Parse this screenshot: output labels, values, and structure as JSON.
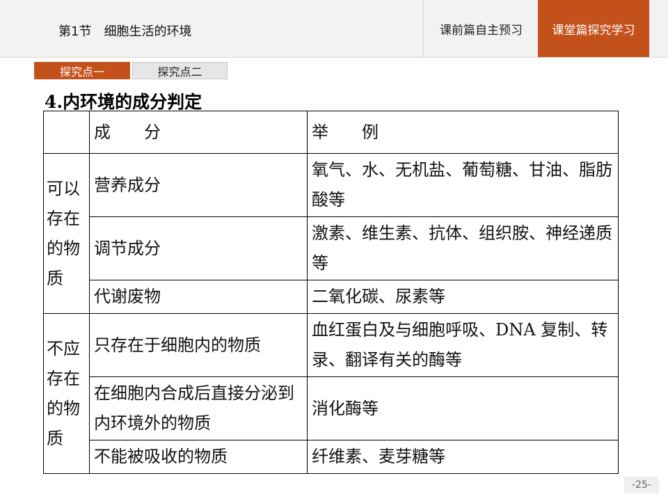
{
  "header": {
    "section_label": "第1节　细胞生活的环境",
    "nav_tabs": [
      {
        "label": "课前篇自主预习",
        "active": false
      },
      {
        "label": "课堂篇探究学习",
        "active": true
      }
    ]
  },
  "subtabs": [
    {
      "label": "探究点一",
      "active": true
    },
    {
      "label": "探究点二",
      "active": false
    }
  ],
  "title": "4.内环境的成分判定",
  "table": {
    "headers": [
      "",
      "成　　分",
      "举　　例"
    ],
    "groups": [
      {
        "label": "可以存在的物质",
        "rows": [
          {
            "component": "营养成分",
            "example": "氧气、水、无机盐、葡萄糖、甘油、脂肪酸等"
          },
          {
            "component": "调节成分",
            "example": "激素、维生素、抗体、组织胺、神经递质等"
          },
          {
            "component": "代谢废物",
            "example": "二氧化碳、尿素等"
          }
        ]
      },
      {
        "label": "不应存在的物质",
        "rows": [
          {
            "component": "只存在于细胞内的物质",
            "example": "血红蛋白及与细胞呼吸、DNA 复制、转录、翻译有关的酶等"
          },
          {
            "component": "在细胞内合成后直接分泌到内环境外的物质",
            "example": "消化酶等"
          },
          {
            "component": "不能被吸收的物质",
            "example": "纤维素、麦芽糖等"
          }
        ]
      }
    ]
  },
  "page_number": "-25-",
  "colors": {
    "accent": "#c4501b",
    "header_bg": "#f2f2f2"
  }
}
